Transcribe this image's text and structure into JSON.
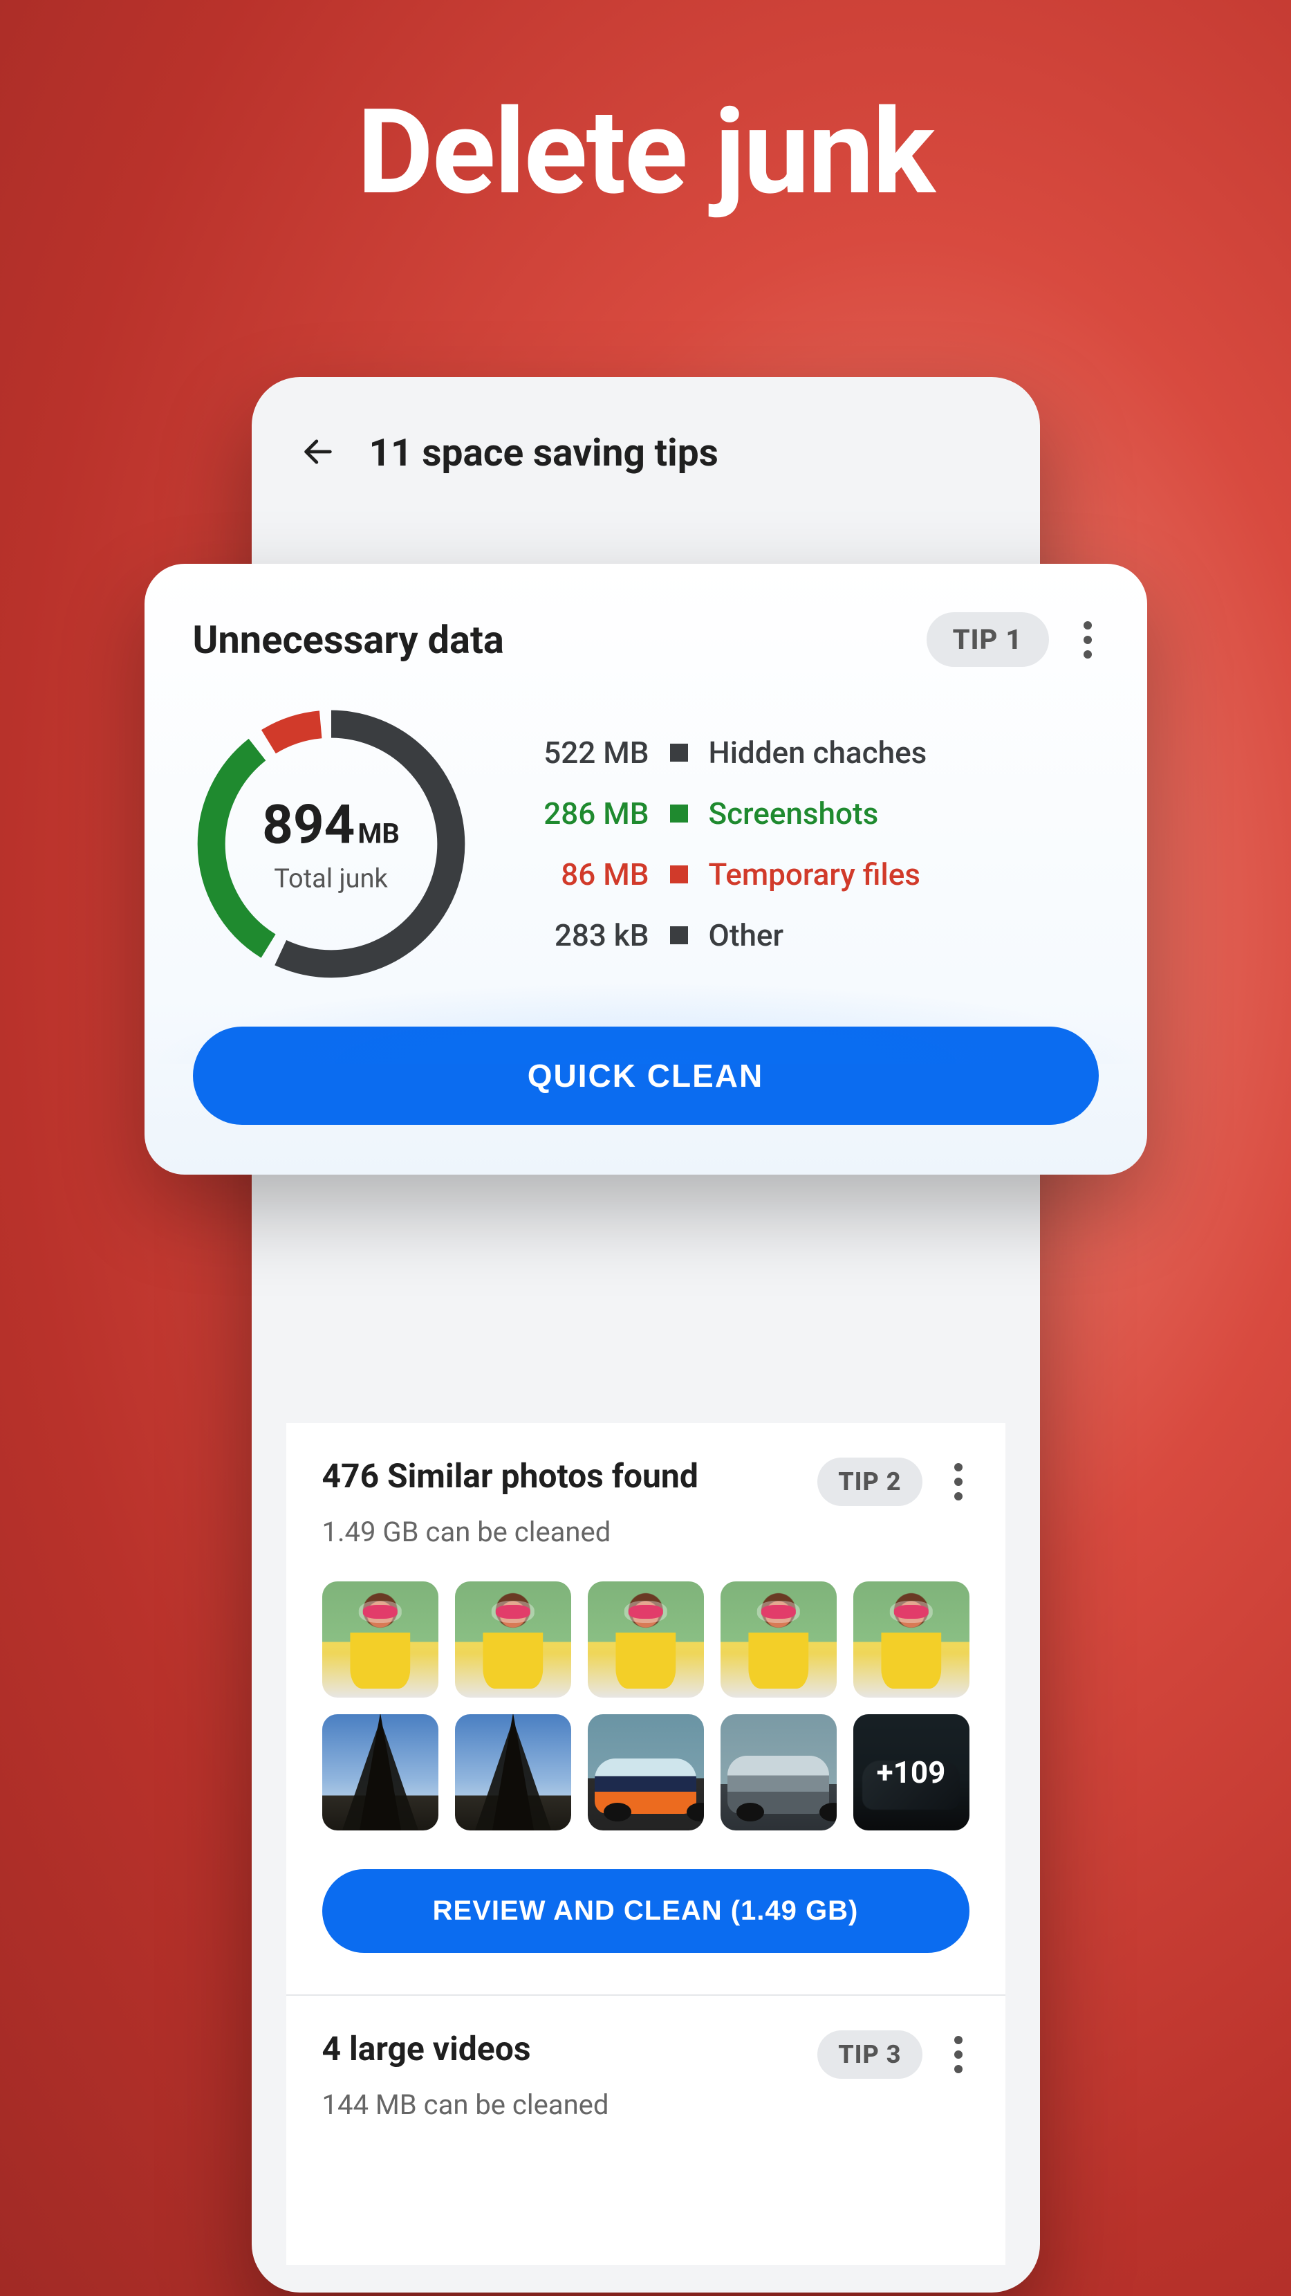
{
  "hero": {
    "title": "Delete junk"
  },
  "header": {
    "title": "11 space saving tips"
  },
  "tip1": {
    "title": "Unnecessary data",
    "badge": "TIP 1",
    "total_value": "894",
    "total_unit": "MB",
    "total_label": "Total junk",
    "legend": [
      {
        "size": "522 MB",
        "label": "Hidden chaches",
        "tone": "dark"
      },
      {
        "size": "286 MB",
        "label": "Screenshots",
        "tone": "green"
      },
      {
        "size": "86 MB",
        "label": "Temporary files",
        "tone": "red"
      },
      {
        "size": "283 kB",
        "label": "Other",
        "tone": "dark"
      }
    ],
    "cta": "QUICK CLEAN"
  },
  "tip2": {
    "title": "476 Similar photos found",
    "badge": "TIP 2",
    "subtitle": "1.49 GB can be cleaned",
    "more_overlay": "+109",
    "cta": "REVIEW AND CLEAN (1.49 GB)"
  },
  "tip3": {
    "title": "4 large videos",
    "badge": "TIP 3",
    "subtitle": "144 MB can be cleaned"
  }
}
